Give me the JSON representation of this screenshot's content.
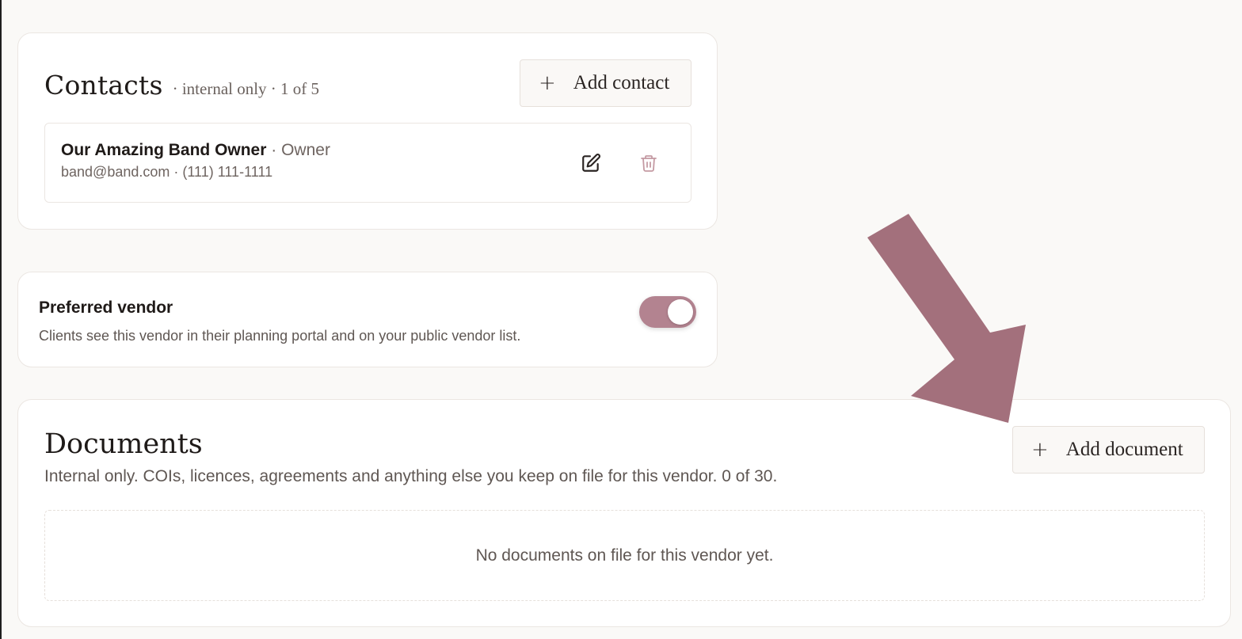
{
  "contacts": {
    "title": "Contacts",
    "subtitle": "· internal only · 1 of 5",
    "add_button": "Add contact",
    "items": [
      {
        "name": "Our Amazing Band Owner",
        "role": "· Owner",
        "details": "band@band.com · (111) 111-1111"
      }
    ]
  },
  "preferred_vendor": {
    "title": "Preferred vendor",
    "description": "Clients see this vendor in their planning portal and on your public vendor list.",
    "enabled": true
  },
  "documents": {
    "title": "Documents",
    "description": "Internal only. COIs, licences, agreements and anything else you keep on file for this vendor. 0 of 30.",
    "add_button": "Add document",
    "empty_message": "No documents on file for this vendor yet."
  },
  "icons": {
    "plus": "plus-icon",
    "edit": "edit-icon",
    "delete": "trash-icon",
    "annotation": "arrow-icon"
  },
  "colors": {
    "accent": "#b38390",
    "arrow": "#a3707c",
    "delete": "#c49aa3"
  }
}
